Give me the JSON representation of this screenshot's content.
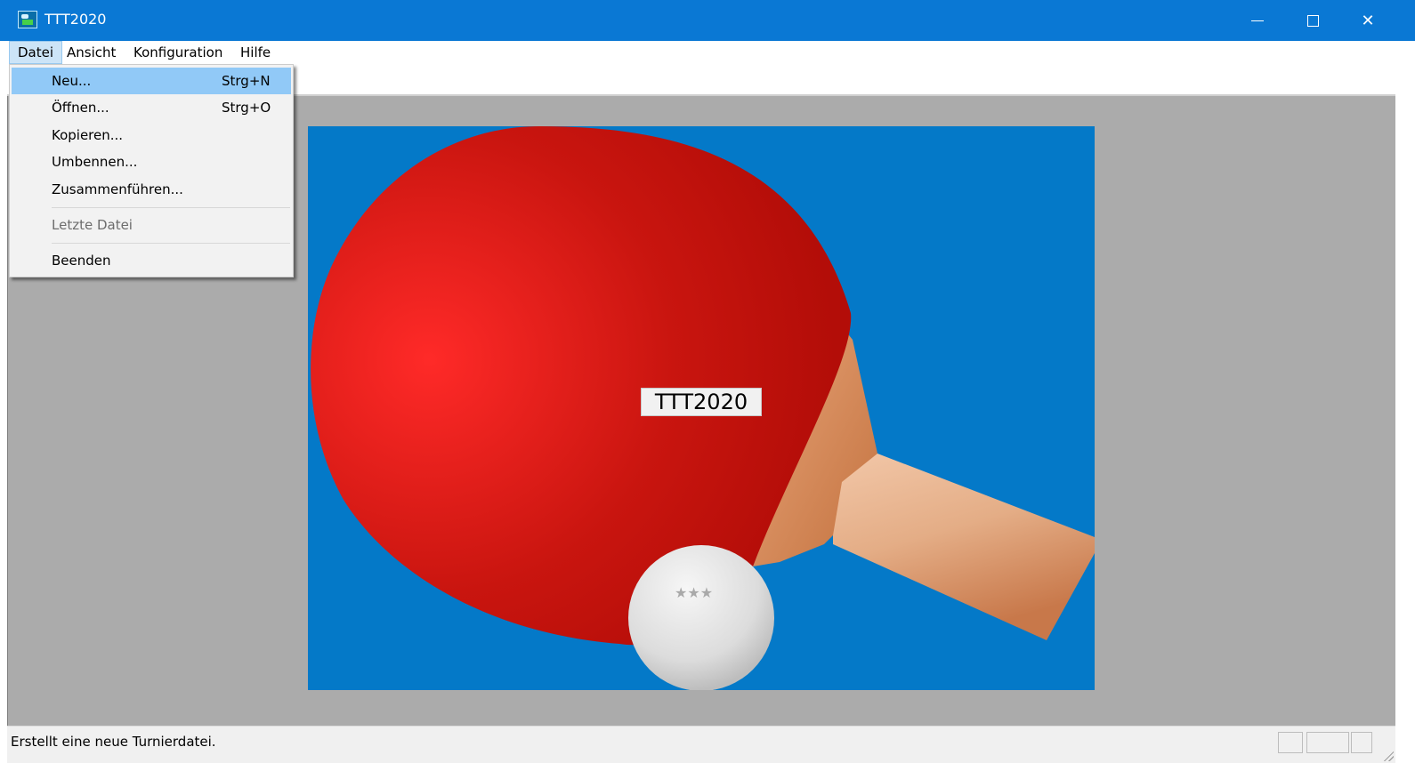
{
  "window": {
    "title": "TTT2020",
    "icon": "app-icon",
    "controls": {
      "minimize": "minimize-icon",
      "maximize": "maximize-icon",
      "close": "✕"
    }
  },
  "menubar": {
    "items": [
      {
        "label": "Datei",
        "active": true
      },
      {
        "label": "Ansicht"
      },
      {
        "label": "Konfiguration"
      },
      {
        "label": "Hilfe"
      }
    ]
  },
  "file_menu": {
    "items": [
      {
        "label": "Neu...",
        "shortcut": "Strg+N",
        "highlighted": true
      },
      {
        "label": "Öffnen...",
        "shortcut": "Strg+O"
      },
      {
        "label": "Kopieren..."
      },
      {
        "label": "Umbennen..."
      },
      {
        "label": "Zusammenführen..."
      },
      {
        "label": "Letzte Datei",
        "disabled": true
      },
      {
        "label": "Beenden"
      }
    ]
  },
  "splash": {
    "label": "TTT2020",
    "background_color": "#0479c8",
    "paddle_color": "#cc1a12",
    "handle_color": "#e0a27a",
    "ball_color": "#e6e6e6"
  },
  "statusbar": {
    "text": "Erstellt eine neue Turnierdatei."
  }
}
